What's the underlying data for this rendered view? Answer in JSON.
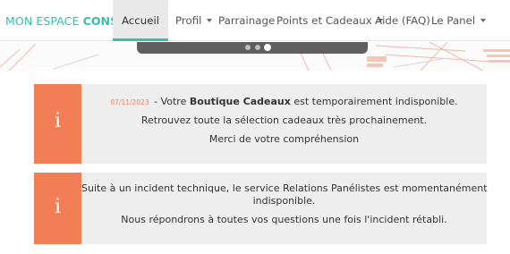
{
  "navbar": {
    "brand_part1": "MON ESPACE ",
    "brand_part2": "CONSO",
    "items": [
      {
        "label": "Accueil",
        "active": true,
        "dropdown": false
      },
      {
        "label": "Profil",
        "active": false,
        "dropdown": true
      },
      {
        "label": "Parrainage",
        "active": false,
        "dropdown": false
      },
      {
        "label": "Points et Cadeaux",
        "active": false,
        "dropdown": true
      },
      {
        "label": "Aide (FAQ)",
        "active": false,
        "dropdown": false
      },
      {
        "label": "Le Panel",
        "active": false,
        "dropdown": true
      }
    ]
  },
  "carousel": {
    "slide_count": 3,
    "active_index": 2
  },
  "alerts": [
    {
      "icon": "info-icon",
      "icon_glyph": "i",
      "date": "07/11/2023",
      "separator": " - ",
      "prefix": "Votre ",
      "bold": "Boutique Cadeaux",
      "suffix": " est temporairement indisponible.",
      "line2": "Retrouvez toute la sélection cadeaux très prochainement.",
      "line3": "Merci de votre compréhension"
    },
    {
      "icon": "info-icon",
      "icon_glyph": "i",
      "line1a": "Suite à un incident technique, le service Relations Panélistes est momentanément",
      "line1b": "indisponible.",
      "line2": "Nous répondrons à toutes vos questions une fois l'incident rétabli."
    }
  ],
  "colors": {
    "brand": "#35bfae",
    "accent": "#f27e55",
    "alert_bg": "#eeeeee",
    "carousel_bar": "#5f5f5f"
  }
}
